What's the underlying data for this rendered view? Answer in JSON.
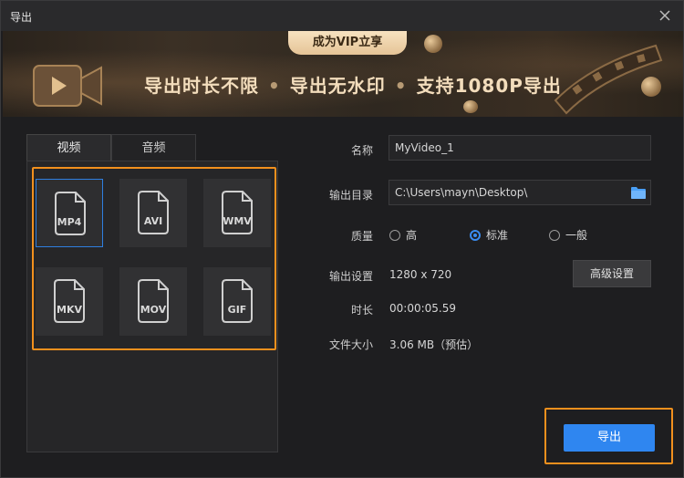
{
  "window": {
    "title": "导出"
  },
  "banner": {
    "vip_label": "成为VIP立享",
    "benefits": [
      "导出时长不限",
      "导出无水印",
      "支持1080P导出"
    ],
    "separator": "•"
  },
  "tabs": [
    {
      "label": "视频",
      "active": true
    },
    {
      "label": "音频",
      "active": false
    }
  ],
  "formats": [
    "MP4",
    "AVI",
    "WMV",
    "MKV",
    "MOV",
    "GIF"
  ],
  "selected_format": "MP4",
  "form": {
    "name_label": "名称",
    "name_value": "MyVideo_1",
    "dir_label": "输出目录",
    "dir_value": "C:\\Users\\mayn\\Desktop\\",
    "quality_label": "质量",
    "quality_options": [
      "高",
      "标准",
      "一般"
    ],
    "quality_selected": "标准",
    "settings_label": "输出设置",
    "settings_value": "1280 x 720",
    "advanced_button": "高级设置",
    "duration_label": "时长",
    "duration_value": "00:00:05.59",
    "size_label": "文件大小",
    "size_value": "3.06 MB（预估）"
  },
  "export_button": "导出",
  "colors": {
    "accent_blue": "#2f86f0",
    "highlight_orange": "#f2901d",
    "vip_gold": "#e5c497"
  }
}
